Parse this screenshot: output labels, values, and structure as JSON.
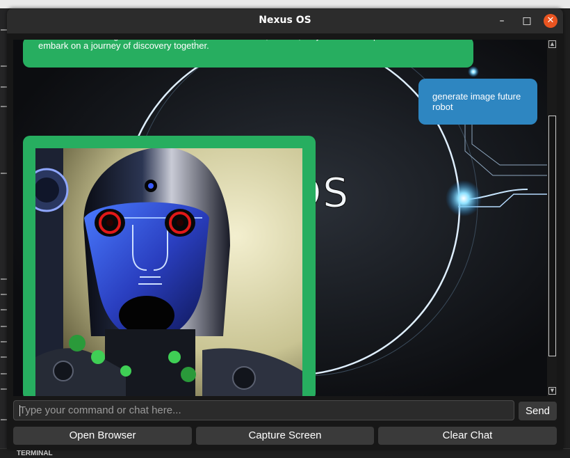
{
  "window": {
    "title": "Nexus OS",
    "controls": {
      "minimize": "–",
      "maximize": "□",
      "close": "✕"
    }
  },
  "chat": {
    "messages": [
      {
        "role": "assistant",
        "text": "intricacies of our digital realm. What aspects of existence, human, do you wish to explore? Let us embark on a journey of discovery together."
      },
      {
        "role": "user",
        "text": "generate image future robot"
      },
      {
        "role": "assistant",
        "type": "image",
        "image_subject": "futuristic robot face with red eyes"
      }
    ],
    "background_text": "Nexus OS"
  },
  "input": {
    "placeholder": "Type your command or chat here...",
    "value": ""
  },
  "buttons": {
    "send": "Send",
    "open_browser": "Open Browser",
    "capture_screen": "Capture Screen",
    "clear_chat": "Clear Chat"
  },
  "background_app": {
    "panel_label": "TERMINAL"
  },
  "colors": {
    "assistant_bubble": "#27ae60",
    "user_bubble": "#2e86c1",
    "close_button": "#e95420"
  }
}
